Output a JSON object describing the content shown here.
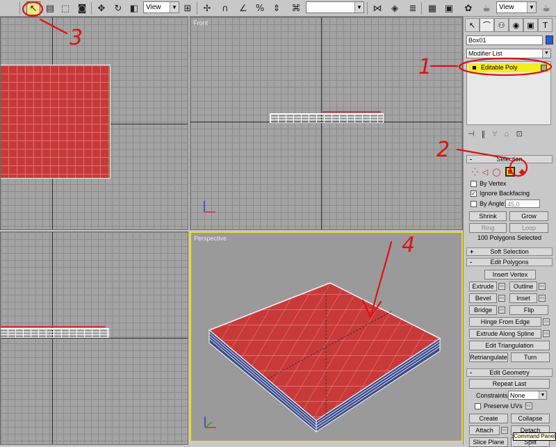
{
  "toolbar": {
    "view_left": "View",
    "view_right": "View",
    "icons": [
      "select-object-icon",
      "select-region-icon",
      "window-crossing-icon",
      "select-move-icon",
      "select-rotate-icon",
      "select-scale-icon",
      "reference-coord-icon",
      "pivot-icon",
      "snap-icon",
      "angle-snap-icon",
      "percent-snap-icon",
      "spinner-snap-icon",
      "named-selection-icon",
      "mirror-icon",
      "align-icon",
      "layer-manager-icon",
      "curve-editor-icon",
      "schematic-view-icon",
      "material-editor-icon",
      "render-scene-icon",
      "quick-render-icon"
    ]
  },
  "viewports": {
    "top": {
      "label": ""
    },
    "front": {
      "label": "Front"
    },
    "left": {
      "label": ""
    },
    "perspective": {
      "label": "Perspective"
    }
  },
  "panel": {
    "object_name": "Box01",
    "modifier_list": "Modifier List",
    "stack_item": "Editable Poly",
    "selection": {
      "title": "Selection",
      "by_vertex": "By Vertex",
      "ignore_backfacing": "Ignore Backfacing",
      "by_angle": "By Angle:",
      "angle_value": "45,0",
      "shrink": "Shrink",
      "grow": "Grow",
      "ring": "Ring",
      "loop": "Loop",
      "status": "100 Polygons Selected"
    },
    "soft_selection": "Soft Selection",
    "edit_polygons": {
      "title": "Edit Polygons",
      "insert_vertex": "Insert Vertex",
      "extrude": "Extrude",
      "outline": "Outline",
      "bevel": "Bevel",
      "inset": "Inset",
      "bridge": "Bridge",
      "flip": "Flip",
      "hinge": "Hinge From Edge",
      "extrude_spline": "Extrude Along Spline",
      "edit_triangulation": "Edit Triangulation",
      "retriangulate": "Retriangulate",
      "turn": "Turn"
    },
    "edit_geometry": {
      "title": "Edit Geometry",
      "repeat_last": "Repeat Last",
      "constraints": "Constraints:",
      "constraints_value": "None",
      "preserve_uvs": "Preserve UVs",
      "create": "Create",
      "collapse": "Collapse",
      "attach": "Attach",
      "detach": "Detach",
      "slice_plane": "Slice Plane",
      "split": "Split"
    },
    "tooltip": "Command Panel"
  },
  "annotations": {
    "n1": "1",
    "n2": "2",
    "n3": "3",
    "n4": "4"
  },
  "colors": {
    "accent_yellow": "#f4ec20",
    "poly_red": "#c83a3a",
    "annotation_red": "#e01010"
  }
}
